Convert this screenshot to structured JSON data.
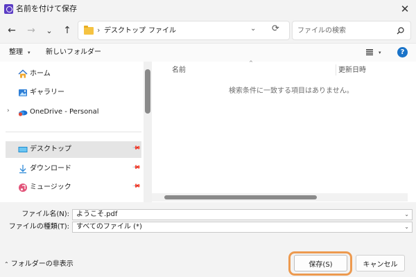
{
  "window": {
    "title": "名前を付けて保存",
    "close_glyph": "✕",
    "icon": "app-icon"
  },
  "nav": {
    "back": "←",
    "forward": "→",
    "recent": "⌄",
    "up": "↑",
    "breadcrumbs": [
      "デスクトップ",
      "ファイル"
    ],
    "separator": "›",
    "dropdown": "⌄",
    "refresh": "⟳"
  },
  "search": {
    "placeholder": "ファイルの検索"
  },
  "commands": {
    "organize": "整理",
    "organize_caret": "▾",
    "new_folder": "新しいフォルダー",
    "view_caret": "▾",
    "help": "?"
  },
  "sidebar": {
    "items": [
      {
        "label": "ホーム",
        "icon": "home-icon"
      },
      {
        "label": "ギャラリー",
        "icon": "gallery-icon"
      },
      {
        "label": "OneDrive - Personal",
        "icon": "onedrive-icon",
        "expand": "›"
      },
      {
        "label": "デスクトップ",
        "icon": "desktop-icon",
        "selected": true
      },
      {
        "label": "ダウンロード",
        "icon": "download-icon"
      },
      {
        "label": "ミュージック",
        "icon": "music-icon"
      }
    ],
    "pin": "📌"
  },
  "main": {
    "columns": {
      "name": "名前",
      "modified": "更新日時"
    },
    "sort_glyph": "^",
    "empty_message": "検索条件に一致する項目はありません。"
  },
  "fields": {
    "filename_label": "ファイル名(N):",
    "filename_value": "ようこそ.pdf",
    "filetype_label": "ファイルの種類(T):",
    "filetype_value": "すべてのファイル (*)",
    "dd": "⌄"
  },
  "footer": {
    "hide_folders": "フォルダーの非表示",
    "hide_caret": "⌃",
    "save": "保存(S)",
    "cancel": "キャンセル"
  },
  "colors": {
    "accent": "#1a73c8",
    "highlight_ring": "#ed9a4f",
    "selected_bg": "#e5e5e5"
  }
}
